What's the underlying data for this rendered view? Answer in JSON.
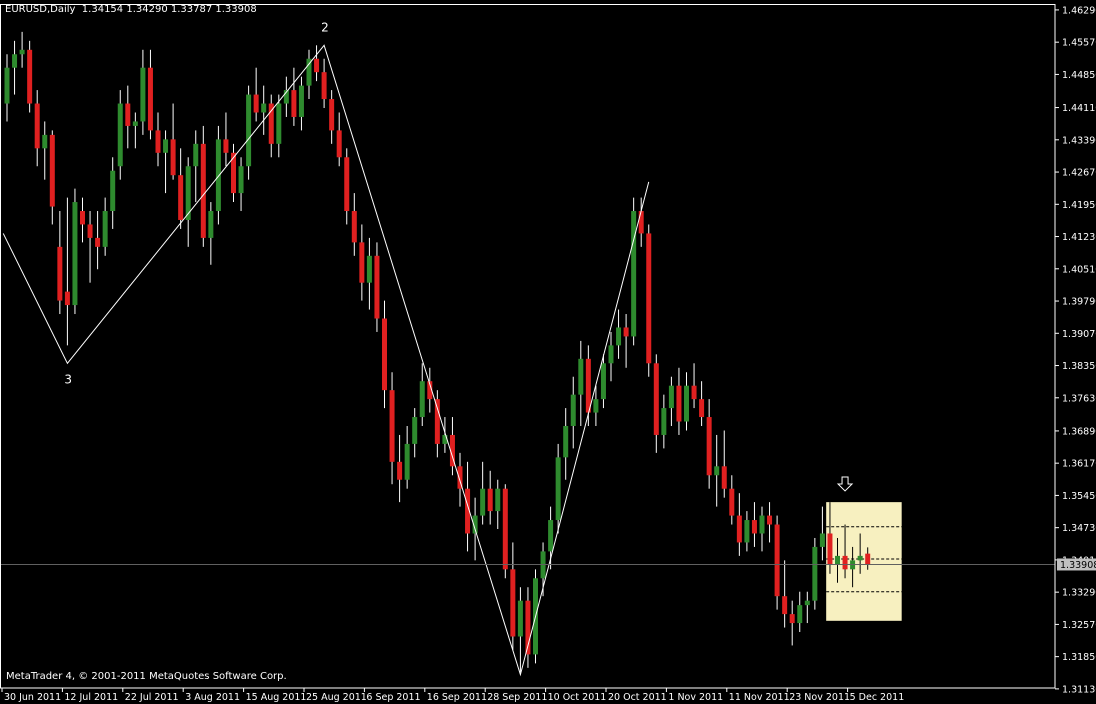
{
  "header": {
    "symbol": "EURUSD,Daily",
    "ohlc": "1.34154 1.34290 1.33787 1.33908"
  },
  "footer": {
    "copyright": "MetaTrader 4, © 2001-2011 MetaQuotes Software Corp."
  },
  "colors": {
    "background": "#000000",
    "foreground": "#ffffff",
    "bull": "#2e8b2e",
    "bear": "#e02020",
    "highlight": "#f7f0c0",
    "current_price_box": "#c0c0c0"
  },
  "chart_data": {
    "type": "candlestick",
    "symbol": "EURUSD",
    "timeframe": "Daily",
    "current_price": 1.33908,
    "ylim": [
      1.3115,
      1.464
    ],
    "y_ticks": [
      "1.46290",
      "1.45570",
      "1.44850",
      "1.44110",
      "1.43390",
      "1.42670",
      "1.41950",
      "1.41230",
      "1.40510",
      "1.39790",
      "1.39070",
      "1.38350",
      "1.37630",
      "1.36890",
      "1.36170",
      "1.35450",
      "1.34730",
      "1.34010",
      "1.33290",
      "1.32570",
      "1.31850",
      "1.31130"
    ],
    "x_ticks": [
      {
        "label": "30 Jun 2011",
        "i": 0
      },
      {
        "label": "12 Jul 2011",
        "i": 8
      },
      {
        "label": "22 Jul 2011",
        "i": 16
      },
      {
        "label": "3 Aug 2011",
        "i": 24
      },
      {
        "label": "15 Aug 2011",
        "i": 32
      },
      {
        "label": "25 Aug 2011",
        "i": 40
      },
      {
        "label": "6 Sep 2011",
        "i": 48
      },
      {
        "label": "16 Sep 2011",
        "i": 56
      },
      {
        "label": "28 Sep 2011",
        "i": 64
      },
      {
        "label": "10 Oct 2011",
        "i": 72
      },
      {
        "label": "20 Oct 2011",
        "i": 80
      },
      {
        "label": "1 Nov 2011",
        "i": 88
      },
      {
        "label": "11 Nov 2011",
        "i": 96
      },
      {
        "label": "23 Nov 2011",
        "i": 104
      },
      {
        "label": "5 Dec 2011",
        "i": 112
      }
    ],
    "zigzag": [
      {
        "i": -0.5,
        "price": 1.413
      },
      {
        "i": 8,
        "price": 1.384,
        "label": "3"
      },
      {
        "i": 42,
        "price": 1.455,
        "label": "2"
      },
      {
        "i": 68,
        "price": 1.3145
      },
      {
        "i": 85,
        "price": 1.4245
      }
    ],
    "highlight_box": {
      "i0": 108.5,
      "i1": 118.5,
      "p_top": 1.353,
      "p_bottom": 1.3265
    },
    "dashed_levels": [
      1.3475,
      1.3403,
      1.333
    ],
    "arrow": {
      "i": 111,
      "price": 1.3555
    },
    "candles": [
      [
        1.442,
        1.453,
        1.438,
        1.45
      ],
      [
        1.45,
        1.456,
        1.444,
        1.453
      ],
      [
        1.453,
        1.458,
        1.45,
        1.454
      ],
      [
        1.454,
        1.456,
        1.44,
        1.442
      ],
      [
        1.442,
        1.445,
        1.428,
        1.432
      ],
      [
        1.432,
        1.438,
        1.425,
        1.435
      ],
      [
        1.435,
        1.436,
        1.415,
        1.419
      ],
      [
        1.41,
        1.418,
        1.395,
        1.398
      ],
      [
        1.4,
        1.421,
        1.388,
        1.397
      ],
      [
        1.397,
        1.423,
        1.395,
        1.42
      ],
      [
        1.418,
        1.421,
        1.411,
        1.415
      ],
      [
        1.415,
        1.418,
        1.402,
        1.412
      ],
      [
        1.412,
        1.418,
        1.405,
        1.41
      ],
      [
        1.41,
        1.421,
        1.408,
        1.418
      ],
      [
        1.418,
        1.43,
        1.414,
        1.427
      ],
      [
        1.428,
        1.445,
        1.425,
        1.442
      ],
      [
        1.442,
        1.446,
        1.432,
        1.437
      ],
      [
        1.437,
        1.44,
        1.432,
        1.438
      ],
      [
        1.438,
        1.454,
        1.435,
        1.45
      ],
      [
        1.45,
        1.454,
        1.434,
        1.436
      ],
      [
        1.436,
        1.44,
        1.428,
        1.431
      ],
      [
        1.431,
        1.436,
        1.422,
        1.434
      ],
      [
        1.434,
        1.442,
        1.425,
        1.426
      ],
      [
        1.426,
        1.432,
        1.414,
        1.416
      ],
      [
        1.416,
        1.43,
        1.41,
        1.428
      ],
      [
        1.428,
        1.436,
        1.42,
        1.433
      ],
      [
        1.433,
        1.437,
        1.41,
        1.412
      ],
      [
        1.412,
        1.42,
        1.406,
        1.418
      ],
      [
        1.418,
        1.437,
        1.415,
        1.434
      ],
      [
        1.434,
        1.44,
        1.428,
        1.431
      ],
      [
        1.431,
        1.433,
        1.42,
        1.422
      ],
      [
        1.422,
        1.43,
        1.418,
        1.428
      ],
      [
        1.428,
        1.446,
        1.425,
        1.444
      ],
      [
        1.444,
        1.45,
        1.438,
        1.44
      ],
      [
        1.44,
        1.446,
        1.435,
        1.442
      ],
      [
        1.442,
        1.444,
        1.43,
        1.433
      ],
      [
        1.433,
        1.444,
        1.43,
        1.442
      ],
      [
        1.442,
        1.448,
        1.439,
        1.445
      ],
      [
        1.445,
        1.45,
        1.437,
        1.439
      ],
      [
        1.439,
        1.448,
        1.436,
        1.446
      ],
      [
        1.446,
        1.454,
        1.443,
        1.452
      ],
      [
        1.452,
        1.455,
        1.447,
        1.449
      ],
      [
        1.449,
        1.452,
        1.441,
        1.443
      ],
      [
        1.443,
        1.445,
        1.433,
        1.436
      ],
      [
        1.436,
        1.44,
        1.428,
        1.43
      ],
      [
        1.43,
        1.432,
        1.415,
        1.418
      ],
      [
        1.418,
        1.422,
        1.408,
        1.411
      ],
      [
        1.411,
        1.415,
        1.398,
        1.402
      ],
      [
        1.402,
        1.412,
        1.396,
        1.408
      ],
      [
        1.408,
        1.411,
        1.391,
        1.394
      ],
      [
        1.394,
        1.398,
        1.374,
        1.378
      ],
      [
        1.378,
        1.382,
        1.357,
        1.362
      ],
      [
        1.362,
        1.368,
        1.353,
        1.358
      ],
      [
        1.358,
        1.37,
        1.356,
        1.366
      ],
      [
        1.366,
        1.374,
        1.363,
        1.372
      ],
      [
        1.372,
        1.384,
        1.37,
        1.38
      ],
      [
        1.38,
        1.383,
        1.373,
        1.376
      ],
      [
        1.376,
        1.378,
        1.363,
        1.366
      ],
      [
        1.366,
        1.372,
        1.364,
        1.368
      ],
      [
        1.368,
        1.372,
        1.359,
        1.361
      ],
      [
        1.361,
        1.364,
        1.352,
        1.356
      ],
      [
        1.356,
        1.362,
        1.342,
        1.346
      ],
      [
        1.346,
        1.354,
        1.34,
        1.35
      ],
      [
        1.35,
        1.362,
        1.348,
        1.356
      ],
      [
        1.356,
        1.36,
        1.348,
        1.351
      ],
      [
        1.351,
        1.358,
        1.347,
        1.356
      ],
      [
        1.356,
        1.357,
        1.336,
        1.338
      ],
      [
        1.338,
        1.344,
        1.32,
        1.323
      ],
      [
        1.323,
        1.334,
        1.315,
        1.331
      ],
      [
        1.331,
        1.334,
        1.316,
        1.319
      ],
      [
        1.319,
        1.338,
        1.317,
        1.336
      ],
      [
        1.336,
        1.344,
        1.332,
        1.342
      ],
      [
        1.342,
        1.352,
        1.338,
        1.349
      ],
      [
        1.349,
        1.366,
        1.346,
        1.363
      ],
      [
        1.363,
        1.374,
        1.358,
        1.37
      ],
      [
        1.37,
        1.381,
        1.365,
        1.377
      ],
      [
        1.377,
        1.389,
        1.37,
        1.385
      ],
      [
        1.385,
        1.388,
        1.37,
        1.373
      ],
      [
        1.373,
        1.379,
        1.37,
        1.376
      ],
      [
        1.376,
        1.386,
        1.374,
        1.384
      ],
      [
        1.384,
        1.391,
        1.38,
        1.388
      ],
      [
        1.388,
        1.396,
        1.385,
        1.392
      ],
      [
        1.392,
        1.395,
        1.383,
        1.39
      ],
      [
        1.39,
        1.421,
        1.388,
        1.418
      ],
      [
        1.418,
        1.421,
        1.41,
        1.413
      ],
      [
        1.413,
        1.415,
        1.381,
        1.384
      ],
      [
        1.384,
        1.386,
        1.364,
        1.368
      ],
      [
        1.368,
        1.377,
        1.365,
        1.374
      ],
      [
        1.374,
        1.381,
        1.37,
        1.379
      ],
      [
        1.379,
        1.383,
        1.368,
        1.371
      ],
      [
        1.371,
        1.382,
        1.369,
        1.379
      ],
      [
        1.379,
        1.384,
        1.374,
        1.376
      ],
      [
        1.376,
        1.38,
        1.37,
        1.372
      ],
      [
        1.372,
        1.376,
        1.356,
        1.359
      ],
      [
        1.359,
        1.368,
        1.352,
        1.361
      ],
      [
        1.361,
        1.369,
        1.354,
        1.356
      ],
      [
        1.356,
        1.359,
        1.348,
        1.35
      ],
      [
        1.35,
        1.355,
        1.341,
        1.344
      ],
      [
        1.344,
        1.351,
        1.342,
        1.349
      ],
      [
        1.349,
        1.353,
        1.343,
        1.346
      ],
      [
        1.346,
        1.352,
        1.342,
        1.35
      ],
      [
        1.35,
        1.353,
        1.344,
        1.348
      ],
      [
        1.348,
        1.35,
        1.329,
        1.332
      ],
      [
        1.332,
        1.34,
        1.325,
        1.328
      ],
      [
        1.328,
        1.331,
        1.321,
        1.326
      ],
      [
        1.326,
        1.333,
        1.324,
        1.33
      ],
      [
        1.33,
        1.333,
        1.326,
        1.331
      ],
      [
        1.331,
        1.345,
        1.329,
        1.343
      ],
      [
        1.343,
        1.352,
        1.34,
        1.346
      ],
      [
        1.346,
        1.353,
        1.337,
        1.339
      ],
      [
        1.339,
        1.345,
        1.335,
        1.341
      ],
      [
        1.341,
        1.348,
        1.336,
        1.338
      ],
      [
        1.338,
        1.343,
        1.334,
        1.34
      ],
      [
        1.34,
        1.346,
        1.337,
        1.341
      ],
      [
        1.3415,
        1.3429,
        1.3379,
        1.3391
      ]
    ]
  }
}
